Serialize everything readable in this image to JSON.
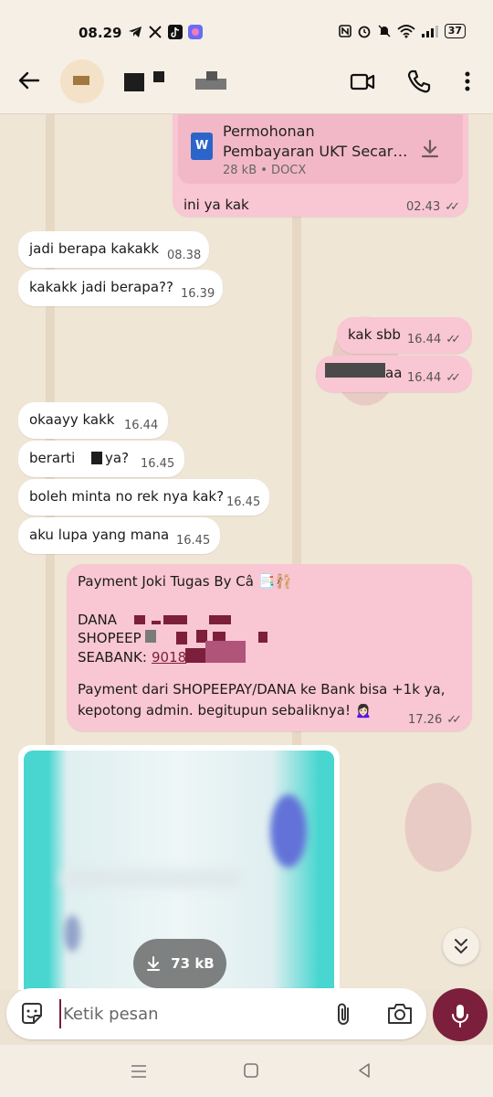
{
  "status_bar": {
    "time": "08.29",
    "battery": "37",
    "app_icons": [
      "telegram-icon",
      "x-icon",
      "tiktok-icon",
      "shortcut-app-icon"
    ],
    "system_icons": [
      "nfc-icon",
      "alarm-icon",
      "mute-icon",
      "wifi-icon",
      "signal-icon"
    ]
  },
  "header": {
    "icons": [
      "back-arrow-icon",
      "video-call-icon",
      "phone-icon",
      "more-options-icon"
    ]
  },
  "messages": {
    "doc": {
      "filename_line1": "Permohonan",
      "filename_line2": "Pembayaran UKT Secara...",
      "meta": "28 kB • DOCX",
      "icon_letter": "W",
      "caption": "ini ya kak",
      "time": "02.43"
    },
    "m1": {
      "text": "jadi berapa kakakk",
      "time": "08.38"
    },
    "m2": {
      "text": "kakakk jadi berapa??",
      "time": "16.39"
    },
    "m3": {
      "text": "kak sbb",
      "time": "16.44"
    },
    "m4": {
      "text": "aa",
      "time": "16.44"
    },
    "m5": {
      "text": "okaayy kakk",
      "time": "16.44"
    },
    "m6": {
      "text_a": "berarti",
      "text_b": "ya?",
      "time": "16.45"
    },
    "m7": {
      "text": "boleh minta no rek nya kak?",
      "time": "16.45"
    },
    "m8": {
      "text": "aku lupa yang mana",
      "time": "16.45"
    },
    "payment": {
      "title": "Payment Joki Tugas By Câ 📑🩰",
      "dana": "DANA",
      "shopee": "SHOPEEP",
      "seabank": "SEABANK:",
      "seabank_link": "9018",
      "note_line1": "Payment dari SHOPEEPAY/DANA ke Bank bisa +1k ya,",
      "note_line2": "kepotong admin. begitupun sebaliknya! 🙍🏻‍♀️",
      "time": "17.26"
    },
    "image": {
      "size": "73 kB"
    }
  },
  "input": {
    "placeholder": "Ketik pesan"
  },
  "colors": {
    "outgoing_bubble": "#f9c6d3",
    "incoming_bubble": "#ffffff",
    "accent": "#7b1f3c"
  }
}
